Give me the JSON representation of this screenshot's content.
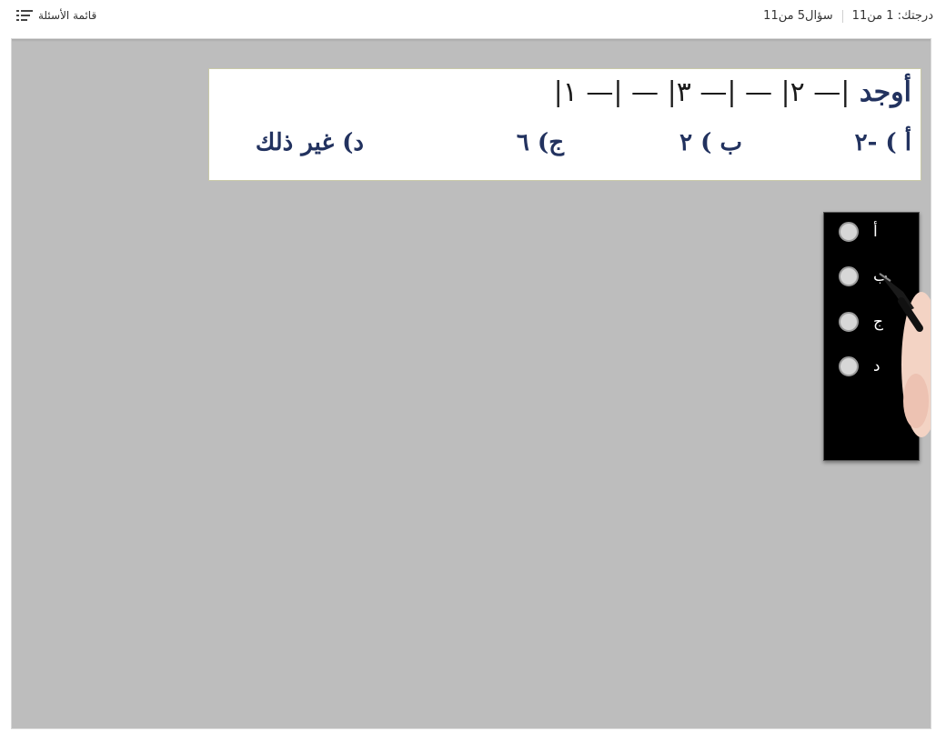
{
  "header": {
    "score_label": "درجتك: 1 من11",
    "question_counter": "سؤال5 من11",
    "question_list_label": "قائمة الأسئلة"
  },
  "question": {
    "prompt_word": "أوجد",
    "expression": "|— ٢| — |— ٣| — |— ١|",
    "answers": {
      "a": "أ ) -٢",
      "b": "ب ) ٢",
      "c": "ج) ٦",
      "d": "د) غير ذلك"
    }
  },
  "options": [
    {
      "label": "أ"
    },
    {
      "label": "ب"
    },
    {
      "label": "ج"
    },
    {
      "label": "د"
    }
  ],
  "colors": {
    "slide_background": "#bdbdbd",
    "question_text": "#22325f",
    "panel_background": "#000000",
    "radio_fill": "#d7d7d7"
  },
  "icons": {
    "question_list": "list-icon",
    "pen_hand": "pen-hand-image"
  }
}
